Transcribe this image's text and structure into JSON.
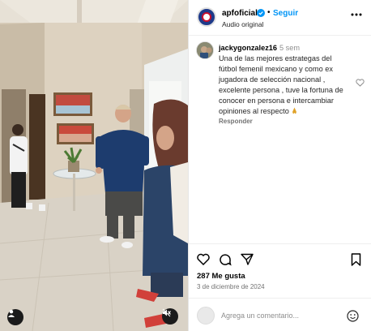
{
  "header": {
    "username": "apfoficial",
    "separator": "•",
    "follow_label": "Seguir",
    "audio_label": "Audio original"
  },
  "comment": {
    "username": "jackygonzalez16",
    "time": "5 sem",
    "text": "Una de las mejores estrategas del fútbol femenil mexicano y como ex jugadora de selección nacional , excelente persona , tuve la fortuna de conocer en persona e intercambiar opiniones al respecto",
    "reply_label": "Responder"
  },
  "post": {
    "likes": "287 Me gusta",
    "date": "3 de diciembre de 2024"
  },
  "add_comment": {
    "placeholder": "Agrega un comentario..."
  },
  "colors": {
    "accent": "#0095f6",
    "text_secondary": "#737373"
  },
  "icons": [
    "verified-badge-icon",
    "more-options-icon",
    "heart-icon",
    "comment-icon",
    "share-icon",
    "bookmark-icon",
    "emoji-icon",
    "user-icon",
    "mute-icon"
  ]
}
